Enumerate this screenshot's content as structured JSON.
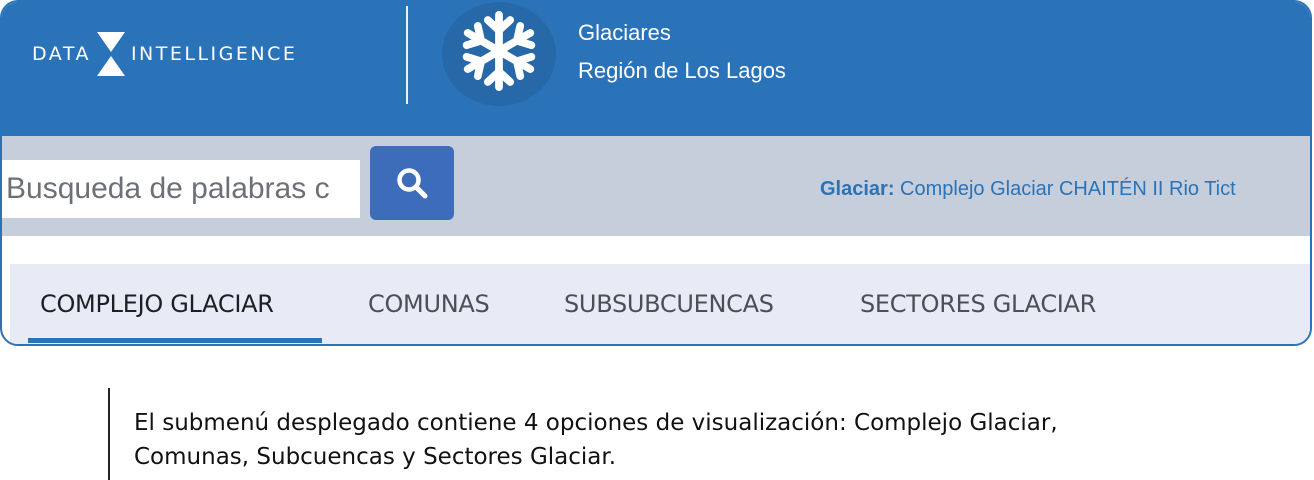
{
  "brand": {
    "word_left": "DATA",
    "word_right": "INTELLIGENCE"
  },
  "header": {
    "title_line1": "Glaciares",
    "title_line2": "Región de Los Lagos"
  },
  "search": {
    "placeholder": "Busqueda de palabras c"
  },
  "glaciar_info": {
    "label": "Glaciar:",
    "value": "Complejo Glaciar CHAITÉN II Rio Tict"
  },
  "tabs": [
    {
      "label": "COMPLEJO GLACIAR",
      "active": true
    },
    {
      "label": "COMUNAS",
      "active": false
    },
    {
      "label": "SUBSUBCUENCAS",
      "active": false
    },
    {
      "label": "SECTORES GLACIAR",
      "active": false
    }
  ],
  "caption": {
    "line1": "El submenú desplegado contiene 4 opciones de visualización: Complejo Glaciar,",
    "line2": "Comunas, Subcuencas y Sectores Glaciar."
  },
  "icons": {
    "logo_mark": "hourglass-triangles-icon",
    "app_icon": "snowflake-icon",
    "search": "search-icon"
  },
  "colors": {
    "header_bg": "#2a73b9",
    "search_band_bg": "#c6cedb",
    "search_button_bg": "#3d6dba",
    "tabs_bg": "#e6ebf5",
    "active_tab_underline": "#2a73b9"
  }
}
